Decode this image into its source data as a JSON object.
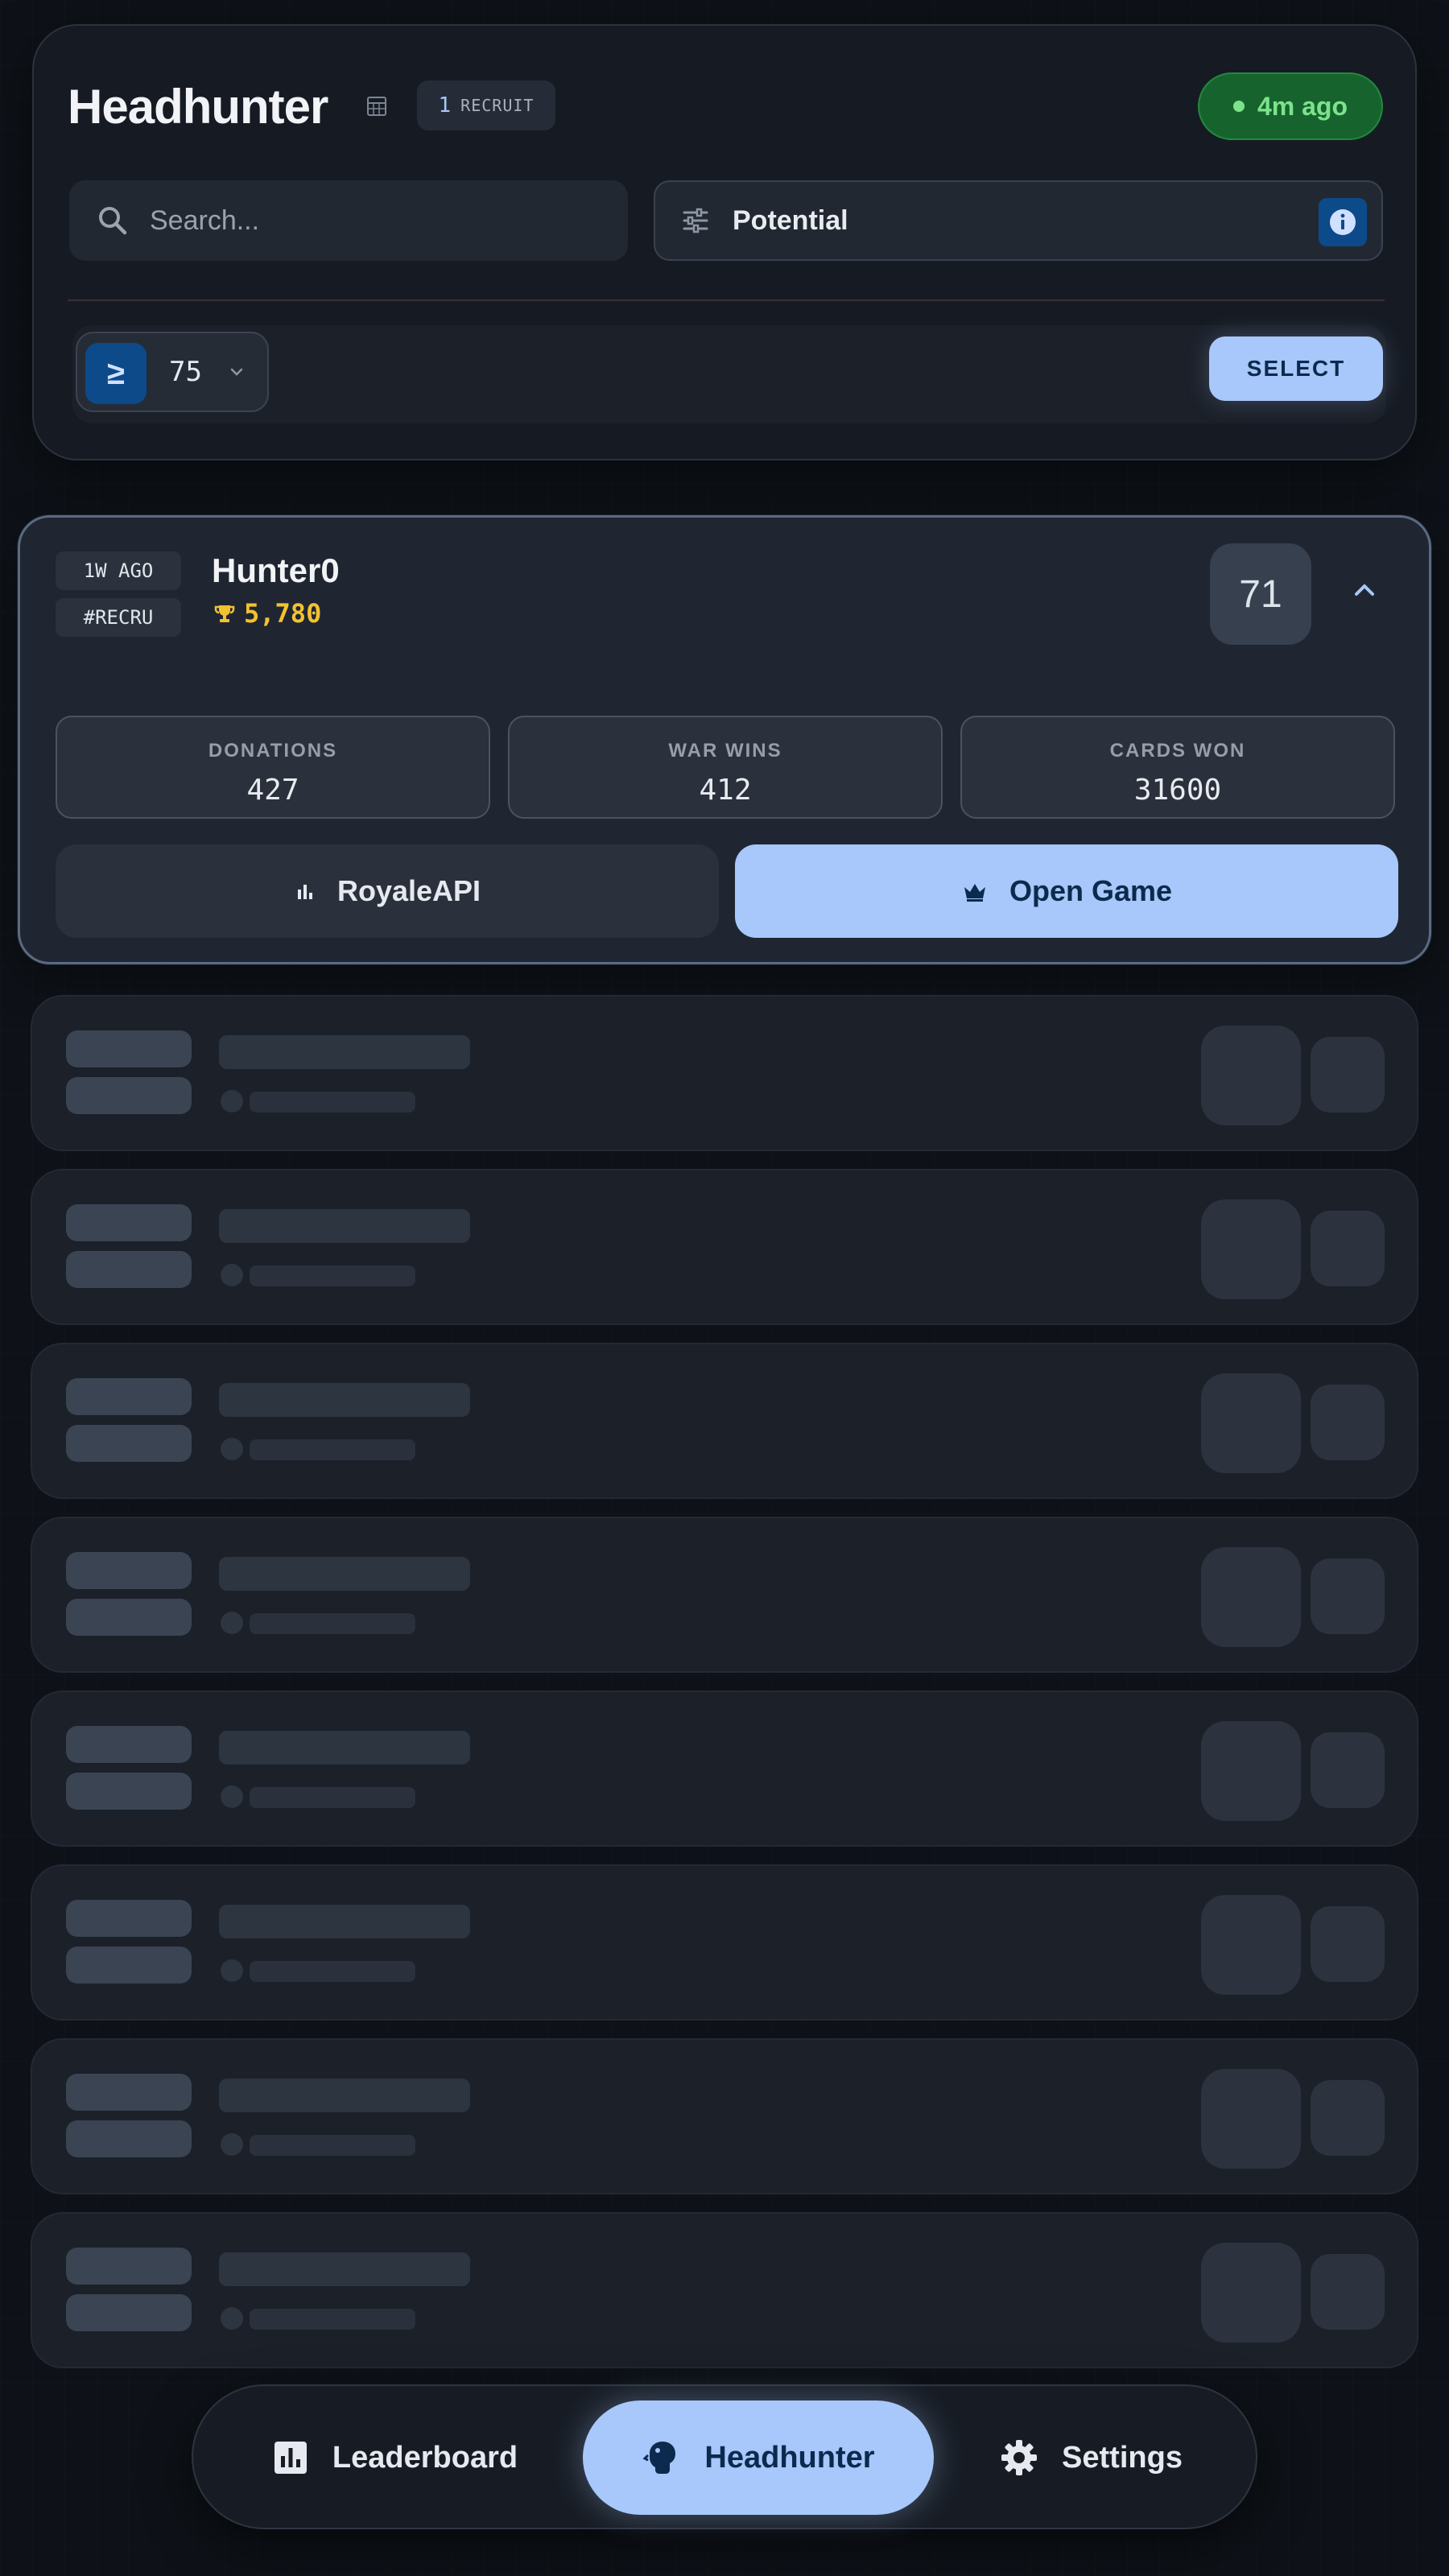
{
  "header": {
    "title": "Headhunter",
    "recruit_count": "1",
    "recruit_label": "RECRUIT",
    "status": "4m ago",
    "search_placeholder": "Search...",
    "filter_label": "Potential",
    "threshold_symbol": "≥",
    "threshold_value": "75",
    "select_label": "SELECT"
  },
  "player": {
    "tags": [
      "1W AGO",
      "#RECRU"
    ],
    "name": "Hunter0",
    "trophies": "5,780",
    "score": "71",
    "stats": [
      {
        "label": "DONATIONS",
        "value": "427"
      },
      {
        "label": "WAR WINS",
        "value": "412"
      },
      {
        "label": "CARDS WON",
        "value": "31600"
      }
    ],
    "royaleapi_label": "RoyaleAPI",
    "open_game_label": "Open Game"
  },
  "nav": {
    "items": [
      {
        "label": "Leaderboard",
        "icon": "bar-chart-icon"
      },
      {
        "label": "Headhunter",
        "icon": "headhunter-icon",
        "active": true
      },
      {
        "label": "Settings",
        "icon": "gear-icon"
      }
    ]
  },
  "colors": {
    "accent": "#a8c7fa",
    "status_green": "#7ce38b",
    "trophy_gold": "#f2c230",
    "background": "#0e1218"
  }
}
